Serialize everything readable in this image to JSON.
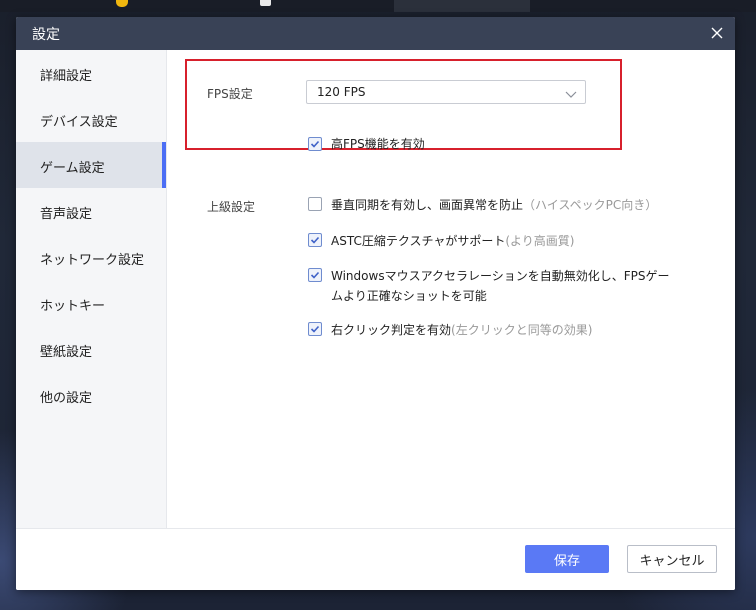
{
  "dialog": {
    "title": "設定"
  },
  "sidebar": {
    "items": [
      {
        "label": "詳細設定"
      },
      {
        "label": "デバイス設定"
      },
      {
        "label": "ゲーム設定",
        "active": true
      },
      {
        "label": "音声設定"
      },
      {
        "label": "ネットワーク設定"
      },
      {
        "label": "ホットキー"
      },
      {
        "label": "壁紙設定"
      },
      {
        "label": "他の設定"
      }
    ]
  },
  "fps": {
    "label": "FPS設定",
    "select_value": "120 FPS",
    "high_fps": {
      "label": "高FPS機能を有効",
      "checked": true
    }
  },
  "advanced": {
    "label": "上級設定",
    "options": [
      {
        "label": "垂直同期を有効し、画面異常を防止",
        "hint": "（ハイスペックPC向き）",
        "checked": false
      },
      {
        "label": "ASTC圧縮テクスチャがサポート",
        "hint": "(より高画質)",
        "checked": true
      },
      {
        "label_line1": "Windowsマウスアクセラレーションを自動無効化し、FPSゲー",
        "label_line2": "ムより正確なショットを可能",
        "checked": true
      },
      {
        "label": "右クリック判定を有効",
        "hint": "(左クリックと同等の効果)",
        "checked": true
      }
    ]
  },
  "footer": {
    "save_label": "保存",
    "cancel_label": "キャンセル"
  },
  "colors": {
    "accent": "#5a79f5",
    "titlebar": "#394256",
    "highlight": "#d7202c"
  }
}
